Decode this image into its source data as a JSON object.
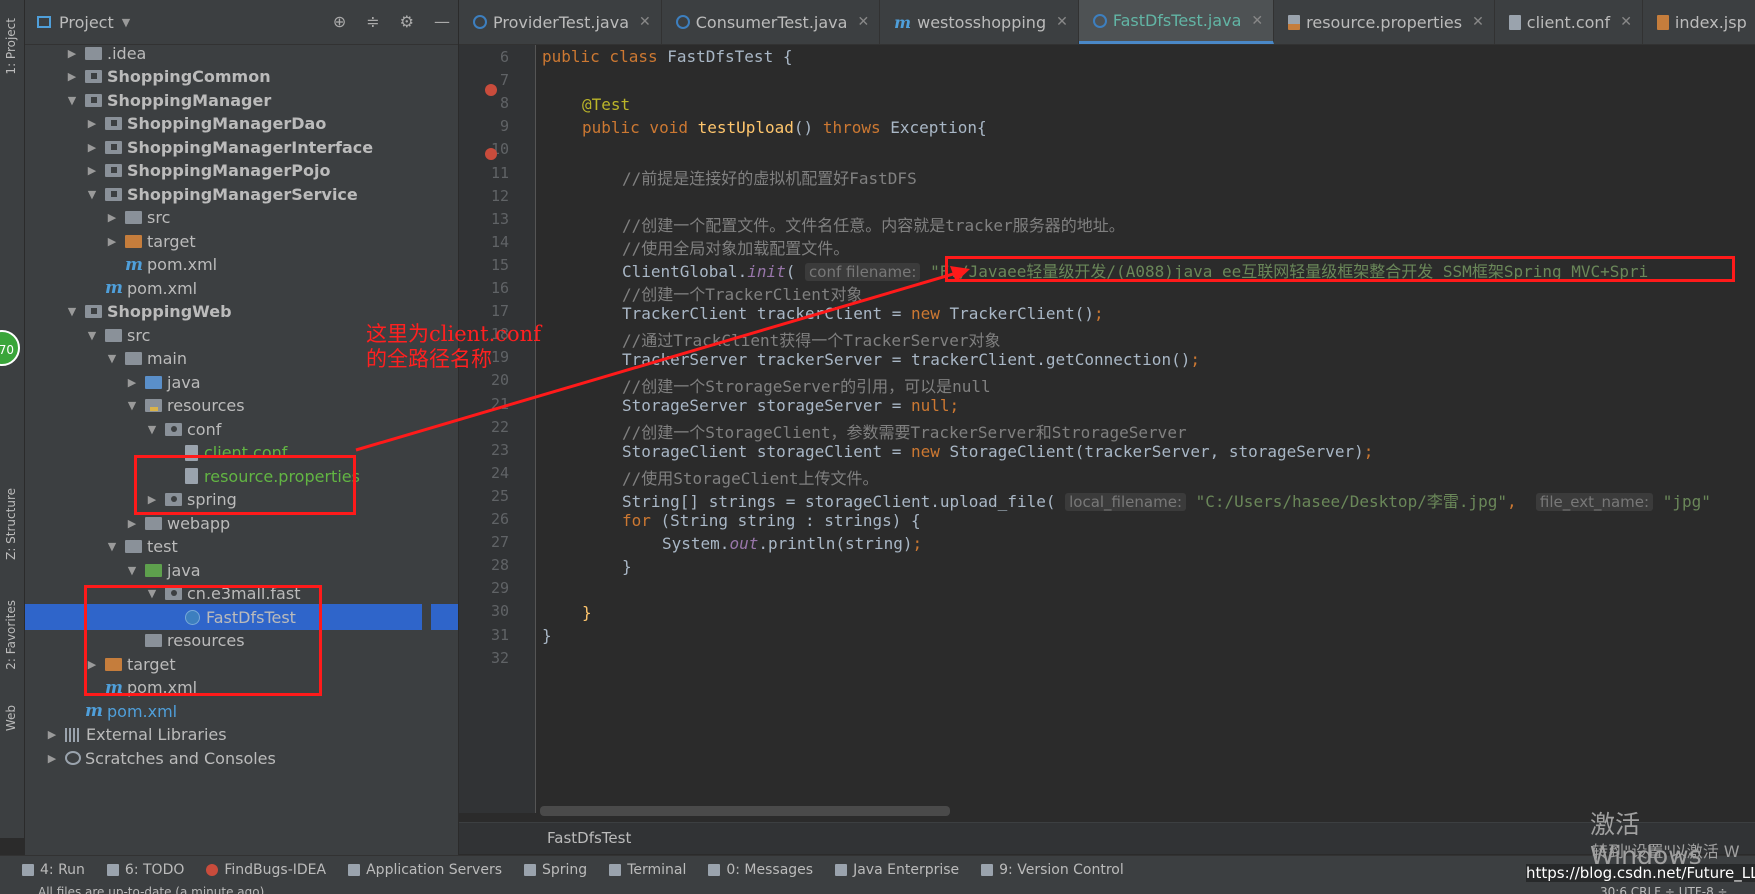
{
  "left_strip": {
    "project_tab": "1: Project",
    "structure_tab": "Z: Structure",
    "favorites_tab": "2: Favorites",
    "web_tab": "Web",
    "badge": "70"
  },
  "project_panel": {
    "title": "Project",
    "tree": [
      {
        "label": ".idea",
        "icon": "folder",
        "level": 1,
        "arrow": "▶"
      },
      {
        "label": "ShoppingCommon",
        "icon": "module-folder",
        "level": 1,
        "arrow": "▶"
      },
      {
        "label": "ShoppingManager",
        "icon": "module-folder",
        "level": 1,
        "arrow": "▼"
      },
      {
        "label": "ShoppingManagerDao",
        "icon": "module-folder",
        "level": 2,
        "arrow": "▶"
      },
      {
        "label": "ShoppingManagerInterface",
        "icon": "module-folder",
        "level": 2,
        "arrow": "▶"
      },
      {
        "label": "ShoppingManagerPojo",
        "icon": "module-folder",
        "level": 2,
        "arrow": "▶"
      },
      {
        "label": "ShoppingManagerService",
        "icon": "module-folder",
        "level": 2,
        "arrow": "▼"
      },
      {
        "label": "src",
        "icon": "folder",
        "level": 3,
        "arrow": "▶"
      },
      {
        "label": "target",
        "icon": "target-folder",
        "level": 3,
        "arrow": "▶"
      },
      {
        "label": "pom.xml",
        "icon": "maven",
        "level": 3,
        "arrow": ""
      },
      {
        "label": "pom.xml",
        "icon": "maven",
        "level": 2,
        "arrow": ""
      },
      {
        "label": "ShoppingWeb",
        "icon": "module-folder",
        "level": 1,
        "arrow": "▼"
      },
      {
        "label": "src",
        "icon": "folder",
        "level": 2,
        "arrow": "▼"
      },
      {
        "label": "main",
        "icon": "folder",
        "level": 3,
        "arrow": "▼"
      },
      {
        "label": "java",
        "icon": "source-folder",
        "level": 4,
        "arrow": "▶"
      },
      {
        "label": "resources",
        "icon": "resources-folder",
        "level": 4,
        "arrow": "▼"
      },
      {
        "label": "conf",
        "icon": "package-folder",
        "level": 5,
        "arrow": "▼"
      },
      {
        "label": "client.conf",
        "icon": "file",
        "level": 6,
        "arrow": "",
        "green": true
      },
      {
        "label": "resource.properties",
        "icon": "file",
        "level": 6,
        "arrow": "",
        "green": true
      },
      {
        "label": "spring",
        "icon": "package-folder",
        "level": 5,
        "arrow": "▶"
      },
      {
        "label": "webapp",
        "icon": "folder",
        "level": 4,
        "arrow": "▶"
      },
      {
        "label": "test",
        "icon": "folder",
        "level": 3,
        "arrow": "▼"
      },
      {
        "label": "java",
        "icon": "test-folder",
        "level": 4,
        "arrow": "▼"
      },
      {
        "label": "cn.e3mall.fast",
        "icon": "package-folder",
        "level": 5,
        "arrow": "▼"
      },
      {
        "label": "FastDfsTest",
        "icon": "class",
        "level": 6,
        "arrow": "",
        "selected": true
      },
      {
        "label": "resources",
        "icon": "folder",
        "level": 4,
        "arrow": ""
      },
      {
        "label": "target",
        "icon": "target-folder",
        "level": 2,
        "arrow": "▶"
      },
      {
        "label": "pom.xml",
        "icon": "maven",
        "level": 2,
        "arrow": ""
      },
      {
        "label": "pom.xml",
        "icon": "maven",
        "level": 1,
        "arrow": ""
      },
      {
        "label": "External Libraries",
        "icon": "library",
        "level": 0,
        "arrow": "▶"
      },
      {
        "label": "Scratches and Consoles",
        "icon": "scratch",
        "level": 0,
        "arrow": "▶"
      }
    ]
  },
  "tabs": [
    {
      "label": "ProviderTest.java",
      "icon": "class"
    },
    {
      "label": "ConsumerTest.java",
      "icon": "class"
    },
    {
      "label": "westosshopping",
      "icon": "maven"
    },
    {
      "label": "FastDfsTest.java",
      "icon": "class",
      "active": true
    },
    {
      "label": "resource.properties",
      "icon": "properties"
    },
    {
      "label": "client.conf",
      "icon": "file"
    },
    {
      "label": "index.jsp",
      "icon": "jsp"
    }
  ],
  "code": {
    "line_numbers": [
      "6",
      "7",
      "8",
      "9",
      "10",
      "11",
      "12",
      "13",
      "14",
      "15",
      "16",
      "17",
      "18",
      "19",
      "20",
      "21",
      "22",
      "23",
      "24",
      "25",
      "26",
      "27",
      "28",
      "29",
      "30",
      "31",
      "32"
    ],
    "l6_a": "public class ",
    "l6_b": "FastDfsTest {",
    "l8": "@Test",
    "l9_a": "public void ",
    "l9_b": "testUpload",
    "l9_c": "() ",
    "l9_d": "throws ",
    "l9_e": "Exception{",
    "l11": "//前提是连接好的虚拟机配置好FastDFS",
    "l13": "//创建一个配置文件。文件名任意。内容就是tracker服务器的地址。",
    "l14": "//使用全局对象加载配置文件。",
    "l15_a": "ClientGlobal.",
    "l15_b": "init",
    "l15_c": "( ",
    "l15_hint": "conf filename:",
    "l15_str": "\"E:/Javaee轻量级开发/(A088)java ee互联网轻量级框架整合开发 SSM框架Spring MVC+Spri",
    "l16": "//创建一个TrackerClient对象",
    "l17_a": "TrackerClient trackerClient = ",
    "l17_b": "new ",
    "l17_c": "TrackerClient()",
    "l17_d": ";",
    "l18": "//通过TrackClient获得一个TrackerServer对象",
    "l19_a": "TrackerServer trackerServer = trackerClient.getConnection()",
    "l19_b": ";",
    "l20": "//创建一个StrorageServer的引用，可以是null",
    "l21_a": "StorageServer storageServer = ",
    "l21_b": "null;",
    "l22": "//创建一个StorageClient，参数需要TrackerServer和StrorageServer",
    "l23_a": "StorageClient storageClient = ",
    "l23_b": "new ",
    "l23_c": "StorageClient(trackerServer, storageServer)",
    "l23_d": ";",
    "l24": "//使用StorageClient上传文件。",
    "l25_a": "String[] strings = storageClient.upload_file( ",
    "l25_hint1": "local_filename:",
    "l25_str1": "\"C:/Users/hasee/Desktop/李雷.jpg\"",
    "l25_comma": ",  ",
    "l25_hint2": "file_ext_name:",
    "l25_str2": "\"jpg\"",
    "l26_a": "for ",
    "l26_b": "(String string : strings) {",
    "l27_a": "System.",
    "l27_b": "out",
    "l27_c": ".println(string)",
    "l27_d": ";",
    "l28": "}",
    "l30": "}",
    "l31": "}"
  },
  "breadcrumb": "FastDfsTest",
  "annotation": {
    "line1": "这里为client.conf",
    "line2": "的全路径名称"
  },
  "tool_windows": [
    {
      "label": "4: Run"
    },
    {
      "label": "6: TODO"
    },
    {
      "label": "FindBugs-IDEA"
    },
    {
      "label": "Application Servers"
    },
    {
      "label": "Spring"
    },
    {
      "label": "Terminal"
    },
    {
      "label": "0: Messages"
    },
    {
      "label": "Java Enterprise"
    },
    {
      "label": "9: Version Control"
    }
  ],
  "status": {
    "message": "All files are up-to-date (a minute ago)",
    "position": "30:6  CRLF ÷  UTF-8 ÷"
  },
  "watermark": {
    "line1": "激活 Windows",
    "line2": "转到\"设置\"以激活 W"
  },
  "csdn_url": "https://blog.csdn.net/Future_LL",
  "colors": {
    "keyword": "#cc7832",
    "string": "#6a8759",
    "comment": "#808080",
    "annotation": "#bbb529",
    "method": "#ffc66d",
    "highlight": "#ff1a1a"
  }
}
